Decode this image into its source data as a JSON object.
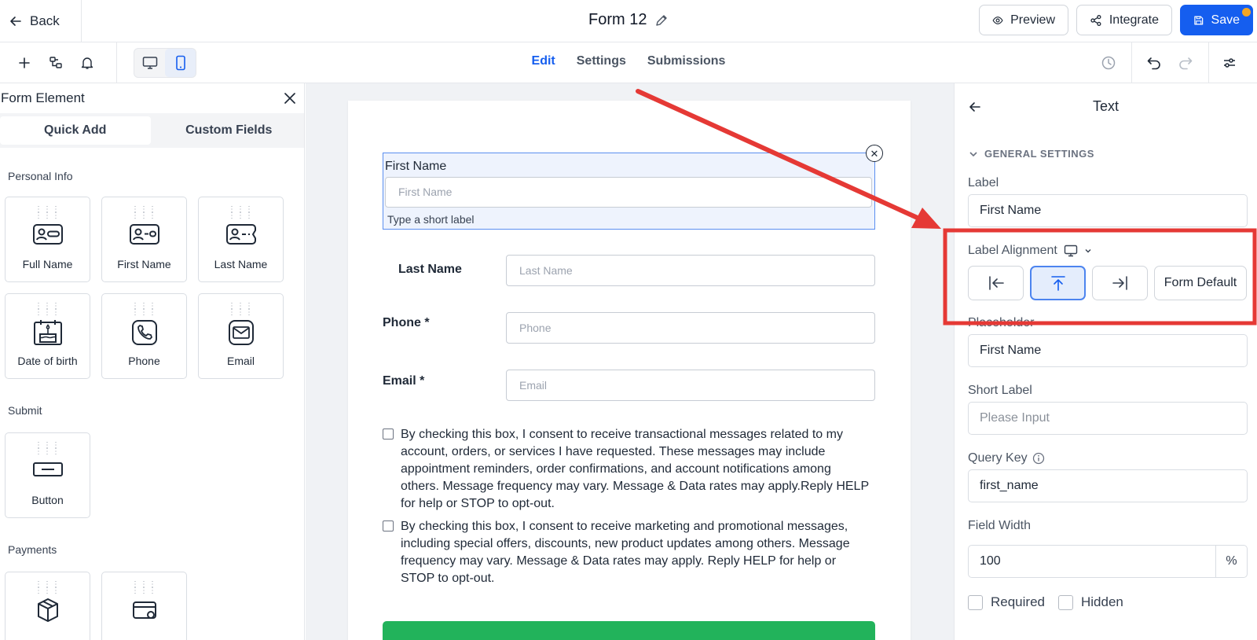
{
  "topbar": {
    "back_label": "Back",
    "form_title": "Form 12",
    "preview_label": "Preview",
    "integrate_label": "Integrate",
    "save_label": "Save"
  },
  "tabs": [
    {
      "label": "Edit",
      "active": true
    },
    {
      "label": "Settings",
      "active": false
    },
    {
      "label": "Submissions",
      "active": false
    }
  ],
  "left_panel": {
    "title": "Form Element",
    "tabs": [
      "Quick Add",
      "Custom Fields"
    ],
    "sections": {
      "personal_info": {
        "title": "Personal Info",
        "items": [
          {
            "label": "Full Name",
            "icon": "id-card-icon"
          },
          {
            "label": "First Name",
            "icon": "id-card-icon"
          },
          {
            "label": "Last Name",
            "icon": "id-card-icon"
          },
          {
            "label": "Date of birth",
            "icon": "cake-icon"
          },
          {
            "label": "Phone",
            "icon": "phone-icon"
          },
          {
            "label": "Email",
            "icon": "mail-icon"
          }
        ]
      },
      "submit": {
        "title": "Submit",
        "items": [
          {
            "label": "Button",
            "icon": "button-icon"
          }
        ]
      },
      "payments": {
        "title": "Payments",
        "items": [
          {
            "label": "",
            "icon": "box-icon"
          },
          {
            "label": "",
            "icon": "card-icon"
          }
        ]
      }
    }
  },
  "form": {
    "first_name": {
      "label": "First Name",
      "placeholder": "First Name",
      "short_label": "Type a short label"
    },
    "last_name": {
      "label": "Last Name",
      "placeholder": "Last Name"
    },
    "phone": {
      "label": "Phone *",
      "placeholder": "Phone"
    },
    "email": {
      "label": "Email *",
      "placeholder": "Email"
    },
    "consent_1": "By checking this box, I consent to receive transactional messages related to my account, orders, or services I have requested. These messages may include appointment reminders, order confirmations, and account notifications among others. Message frequency may vary. Message & Data rates may apply.Reply HELP for help or STOP to opt-out.",
    "consent_2": "By checking this box, I consent to receive marketing and promotional messages, including special offers, discounts, new product updates among others. Message frequency may vary. Message & Data rates may apply. Reply HELP for help or STOP to opt-out."
  },
  "right_panel": {
    "title": "Text",
    "section": "GENERAL SETTINGS",
    "label_title": "Label",
    "label_value": "First Name",
    "alignment_title": "Label Alignment",
    "alignment_options": [
      "left",
      "top",
      "right",
      "Form Default"
    ],
    "alignment_selected": "top",
    "placeholder_title": "Placeholder",
    "placeholder_value": "First Name",
    "short_label_title": "Short Label",
    "short_label_placeholder": "Please Input",
    "query_key_title": "Query Key",
    "query_key_value": "first_name",
    "field_width_title": "Field Width",
    "field_width_value": "100",
    "field_width_unit": "%",
    "required_label": "Required",
    "hidden_label": "Hidden"
  },
  "colors": {
    "accent": "#155eef",
    "annotation": "#e53935",
    "submit": "#22b35b"
  }
}
